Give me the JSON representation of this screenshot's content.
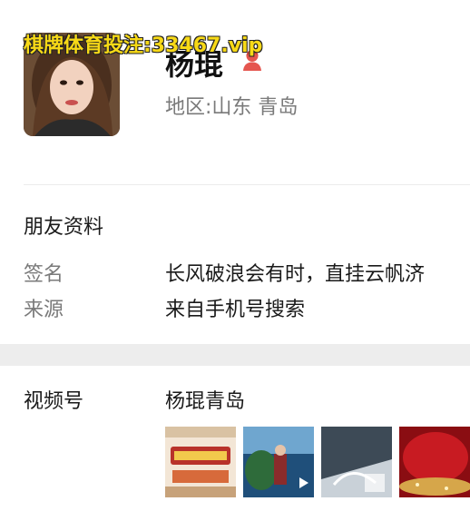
{
  "watermark": "棋牌体育投注:33467.vip",
  "profile": {
    "name": "杨琨",
    "gender_icon": "female-user-icon",
    "region": "地区:山东 青岛"
  },
  "friend_info": {
    "section_title": "朋友资料",
    "signature_label": "签名",
    "signature_value": "长风破浪会有时，直挂云帆济",
    "source_label": "来源",
    "source_value": "来自手机号搜索"
  },
  "channels": {
    "label": "视频号",
    "name": "杨琨青岛",
    "thumbnails": [
      "thumb-1",
      "thumb-2",
      "thumb-3",
      "thumb-4"
    ]
  },
  "colors": {
    "accent_red": "#e5564f",
    "label_gray": "#7a7a7a",
    "section_bg": "#ededed"
  }
}
